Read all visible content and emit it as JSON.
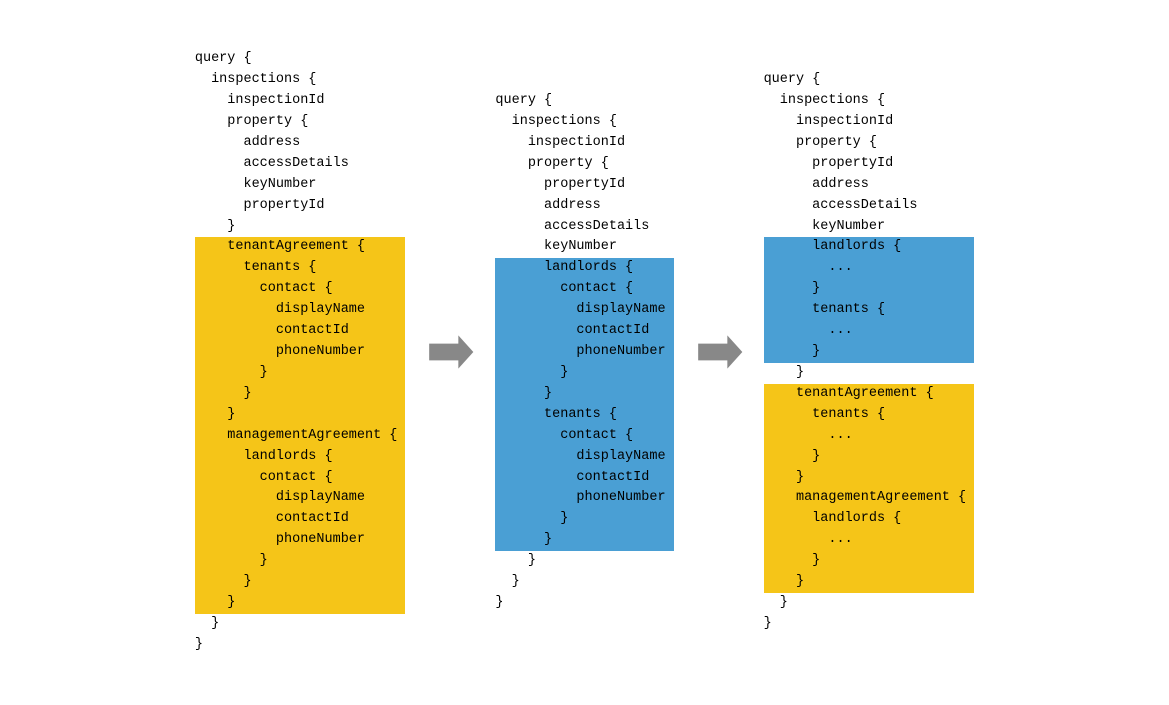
{
  "diagram": {
    "blocks": [
      {
        "id": "block1",
        "lines": [
          {
            "text": "query {",
            "highlight": "none"
          },
          {
            "text": "  inspections {",
            "highlight": "none"
          },
          {
            "text": "    inspectionId",
            "highlight": "none"
          },
          {
            "text": "    property {",
            "highlight": "none"
          },
          {
            "text": "      address",
            "highlight": "none"
          },
          {
            "text": "      accessDetails",
            "highlight": "none"
          },
          {
            "text": "      keyNumber",
            "highlight": "none"
          },
          {
            "text": "      propertyId",
            "highlight": "none"
          },
          {
            "text": "    }",
            "highlight": "none"
          },
          {
            "text": "    tenantAgreement {",
            "highlight": "yellow"
          },
          {
            "text": "      tenants {",
            "highlight": "yellow"
          },
          {
            "text": "        contact {",
            "highlight": "yellow"
          },
          {
            "text": "          displayName",
            "highlight": "yellow"
          },
          {
            "text": "          contactId",
            "highlight": "yellow"
          },
          {
            "text": "          phoneNumber",
            "highlight": "yellow"
          },
          {
            "text": "        }",
            "highlight": "yellow"
          },
          {
            "text": "      }",
            "highlight": "yellow"
          },
          {
            "text": "    }",
            "highlight": "yellow"
          },
          {
            "text": "    managementAgreement {",
            "highlight": "yellow"
          },
          {
            "text": "      landlords {",
            "highlight": "yellow"
          },
          {
            "text": "        contact {",
            "highlight": "yellow"
          },
          {
            "text": "          displayName",
            "highlight": "yellow"
          },
          {
            "text": "          contactId",
            "highlight": "yellow"
          },
          {
            "text": "          phoneNumber",
            "highlight": "yellow"
          },
          {
            "text": "        }",
            "highlight": "yellow"
          },
          {
            "text": "      }",
            "highlight": "yellow"
          },
          {
            "text": "    }",
            "highlight": "yellow"
          },
          {
            "text": "  }",
            "highlight": "none"
          },
          {
            "text": "}",
            "highlight": "none"
          }
        ]
      },
      {
        "id": "block2",
        "lines": [
          {
            "text": "query {",
            "highlight": "none"
          },
          {
            "text": "  inspections {",
            "highlight": "none"
          },
          {
            "text": "    inspectionId",
            "highlight": "none"
          },
          {
            "text": "    property {",
            "highlight": "none"
          },
          {
            "text": "      propertyId",
            "highlight": "none"
          },
          {
            "text": "      address",
            "highlight": "none"
          },
          {
            "text": "      accessDetails",
            "highlight": "none"
          },
          {
            "text": "      keyNumber",
            "highlight": "none"
          },
          {
            "text": "      landlords {",
            "highlight": "blue"
          },
          {
            "text": "        contact {",
            "highlight": "blue"
          },
          {
            "text": "          displayName",
            "highlight": "blue"
          },
          {
            "text": "          contactId",
            "highlight": "blue"
          },
          {
            "text": "          phoneNumber",
            "highlight": "blue"
          },
          {
            "text": "        }",
            "highlight": "blue"
          },
          {
            "text": "      }",
            "highlight": "blue"
          },
          {
            "text": "      tenants {",
            "highlight": "blue"
          },
          {
            "text": "        contact {",
            "highlight": "blue"
          },
          {
            "text": "          displayName",
            "highlight": "blue"
          },
          {
            "text": "          contactId",
            "highlight": "blue"
          },
          {
            "text": "          phoneNumber",
            "highlight": "blue"
          },
          {
            "text": "        }",
            "highlight": "blue"
          },
          {
            "text": "      }",
            "highlight": "blue"
          },
          {
            "text": "    }",
            "highlight": "none"
          },
          {
            "text": "  }",
            "highlight": "none"
          },
          {
            "text": "}",
            "highlight": "none"
          }
        ]
      },
      {
        "id": "block3",
        "lines": [
          {
            "text": "query {",
            "highlight": "none"
          },
          {
            "text": "  inspections {",
            "highlight": "none"
          },
          {
            "text": "    inspectionId",
            "highlight": "none"
          },
          {
            "text": "    property {",
            "highlight": "none"
          },
          {
            "text": "      propertyId",
            "highlight": "none"
          },
          {
            "text": "      address",
            "highlight": "none"
          },
          {
            "text": "      accessDetails",
            "highlight": "none"
          },
          {
            "text": "      keyNumber",
            "highlight": "none"
          },
          {
            "text": "      landlords {",
            "highlight": "blue"
          },
          {
            "text": "        ...",
            "highlight": "blue"
          },
          {
            "text": "      }",
            "highlight": "blue"
          },
          {
            "text": "      tenants {",
            "highlight": "blue"
          },
          {
            "text": "        ...",
            "highlight": "blue"
          },
          {
            "text": "      }",
            "highlight": "blue"
          },
          {
            "text": "    }",
            "highlight": "none"
          },
          {
            "text": "    tenantAgreement {",
            "highlight": "yellow"
          },
          {
            "text": "      tenants {",
            "highlight": "yellow"
          },
          {
            "text": "        ...",
            "highlight": "yellow"
          },
          {
            "text": "      }",
            "highlight": "yellow"
          },
          {
            "text": "    }",
            "highlight": "yellow"
          },
          {
            "text": "    managementAgreement {",
            "highlight": "yellow"
          },
          {
            "text": "      landlords {",
            "highlight": "yellow"
          },
          {
            "text": "        ...",
            "highlight": "yellow"
          },
          {
            "text": "      }",
            "highlight": "yellow"
          },
          {
            "text": "    }",
            "highlight": "yellow"
          },
          {
            "text": "  }",
            "highlight": "none"
          },
          {
            "text": "}",
            "highlight": "none"
          }
        ]
      }
    ],
    "arrows": [
      {
        "id": "arrow1"
      },
      {
        "id": "arrow2"
      }
    ]
  }
}
